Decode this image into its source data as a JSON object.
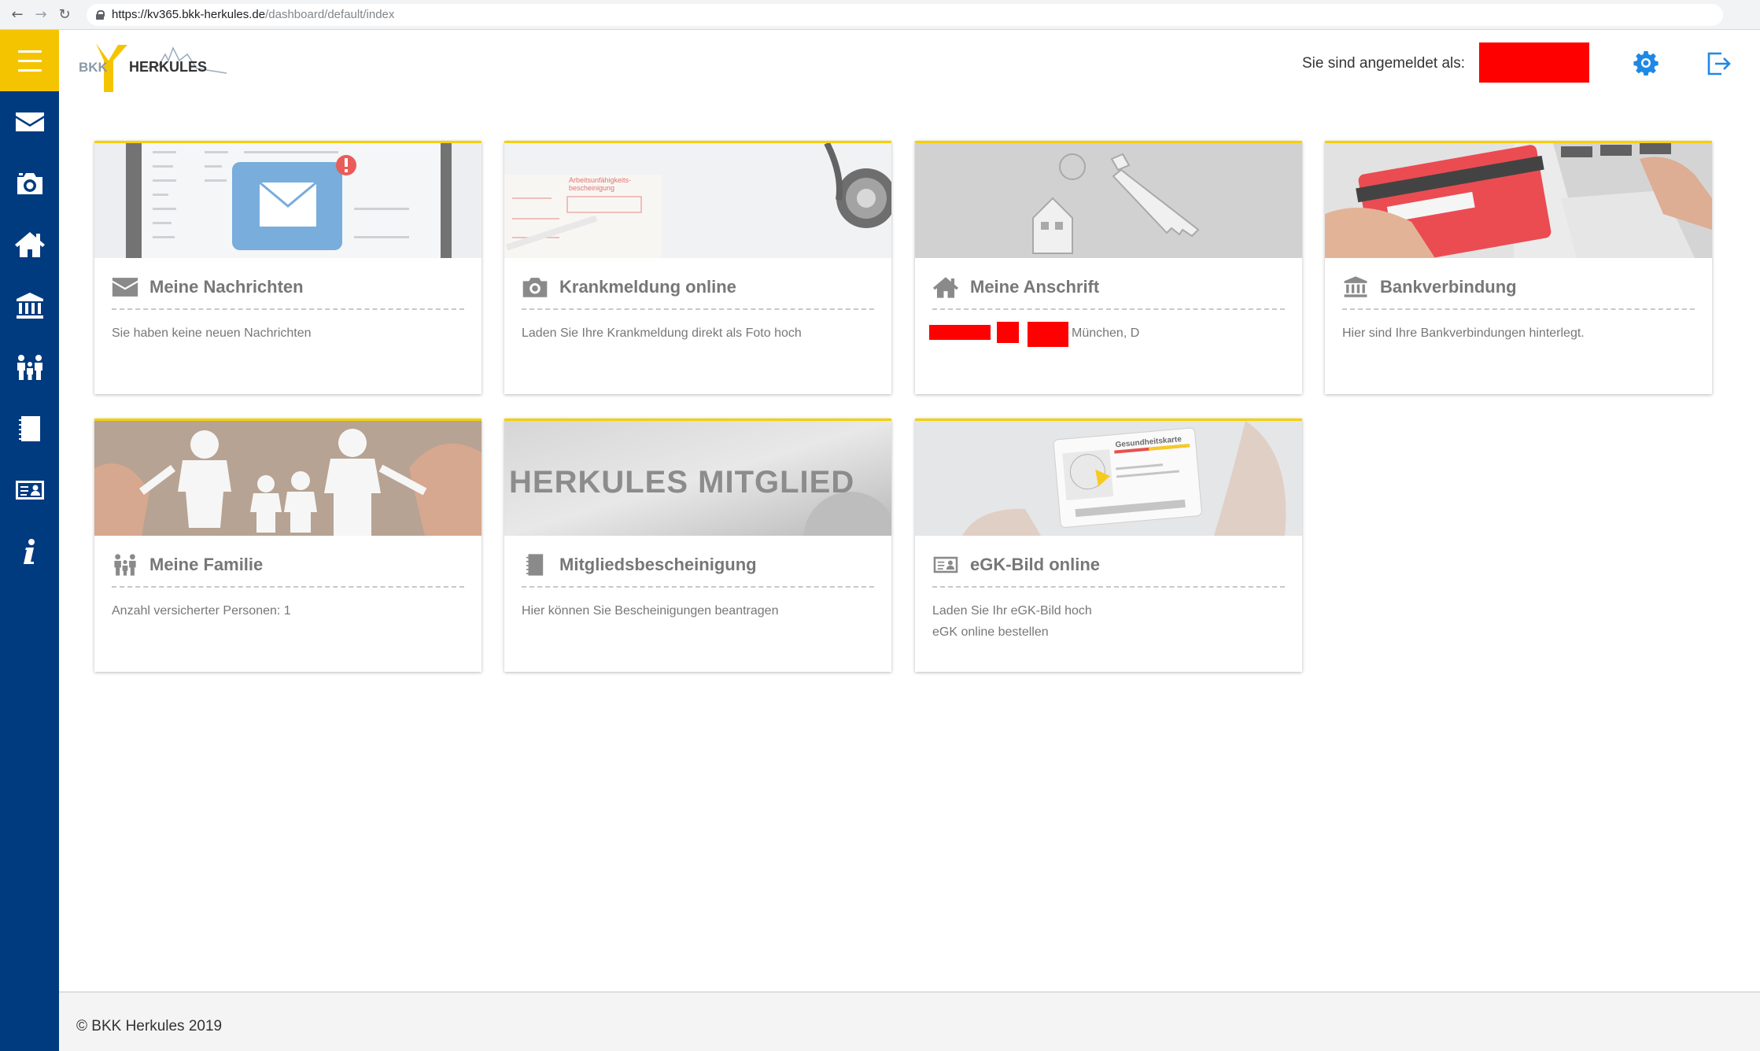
{
  "browser": {
    "url_host": "https://kv365.bkk-herkules.de",
    "url_path": "/dashboard/default/index"
  },
  "sidebar": {
    "items": [
      {
        "icon": "envelope-icon"
      },
      {
        "icon": "camera-icon"
      },
      {
        "icon": "home-icon"
      },
      {
        "icon": "bank-icon"
      },
      {
        "icon": "family-icon"
      },
      {
        "icon": "notebook-icon"
      },
      {
        "icon": "id-card-icon"
      },
      {
        "icon": "info-icon"
      }
    ]
  },
  "header": {
    "logo_bkk": "BKK",
    "logo_name": "HERKULES",
    "login_label": "Sie sind angemeldet als:"
  },
  "cards": [
    {
      "title": "Meine Nachrichten",
      "desc": "Sie haben keine neuen Nachrichten"
    },
    {
      "title": "Krankmeldung online",
      "desc": "Laden Sie Ihre Krankmeldung direkt als Foto hoch",
      "image_text_1": "Arbeitsunfähigkeits-",
      "image_text_2": "bescheinigung"
    },
    {
      "title": "Meine Anschrift",
      "desc_suffix": "München, D"
    },
    {
      "title": "Bankverbindung",
      "desc": "Hier sind Ihre Bankverbindungen hinterlegt."
    },
    {
      "title": "Meine Familie",
      "desc": "Anzahl versicherter Personen: 1"
    },
    {
      "title": "Mitgliedsbescheinigung",
      "desc": "Hier können Sie Bescheinigungen beantragen",
      "image_text": "HERKULES MITGLIED"
    },
    {
      "title": "eGK-Bild online",
      "desc_line1": "Laden Sie Ihr eGK-Bild hoch",
      "desc_line2": "eGK online bestellen",
      "image_text": "Gesundheitskarte"
    }
  ],
  "footer": {
    "copyright": "© BKK Herkules 2019"
  },
  "colors": {
    "sidebar": "#003b80",
    "menu_button": "#f5c400",
    "card_accent": "#f5d000",
    "redaction": "#ff0000",
    "icon_blue": "#1e88e5"
  }
}
